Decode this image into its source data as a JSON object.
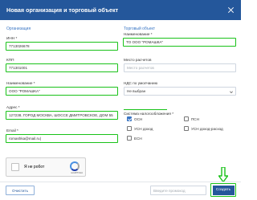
{
  "dialog": {
    "title": "Новая организация и торговый объект"
  },
  "organization": {
    "section_title": "Организация",
    "inn": {
      "label": "ИНН *",
      "value": "7713026678"
    },
    "kpp": {
      "label": "КПП",
      "value": "771301001"
    },
    "name": {
      "label": "Наименование *",
      "value": "ООО \"РОМАШКА\""
    },
    "address": {
      "label": "Адрес *",
      "value": "127238, ГОРОД МОСКВА, ШОССЕ ДМИТРОВСКОЕ, ДОМ 55"
    },
    "email": {
      "label": "Email *",
      "value": "romashka@mail.ru|"
    }
  },
  "store": {
    "section_title": "Торговый объект",
    "name": {
      "label": "Наименование *",
      "value": "ТО ООО \"РОМАШКА\""
    },
    "place": {
      "label": "Место расчетов",
      "placeholder": "Место расчетов"
    },
    "vat": {
      "label": "НДС по умолчанию",
      "value": "Не выбран"
    },
    "tax": {
      "label": "Система налогообложения *",
      "options": [
        {
          "label": "ОСН",
          "checked": true
        },
        {
          "label": "ПСН",
          "checked": false
        },
        {
          "label": "УСН доход",
          "checked": false
        },
        {
          "label": "УСН доход-расход",
          "checked": false
        },
        {
          "label": "ЕСН",
          "checked": false
        }
      ]
    }
  },
  "captcha": {
    "label": "Я не робот",
    "brand": "reCAPTCHA",
    "terms": "Конфиденциальность - Условия использования"
  },
  "footer": {
    "clear_label": "Очистить",
    "promo_placeholder": "Введите промокод",
    "create_label": "Создать"
  },
  "colors": {
    "header": "#24579b",
    "accent": "#3a76c4",
    "highlight": "#19c219"
  }
}
